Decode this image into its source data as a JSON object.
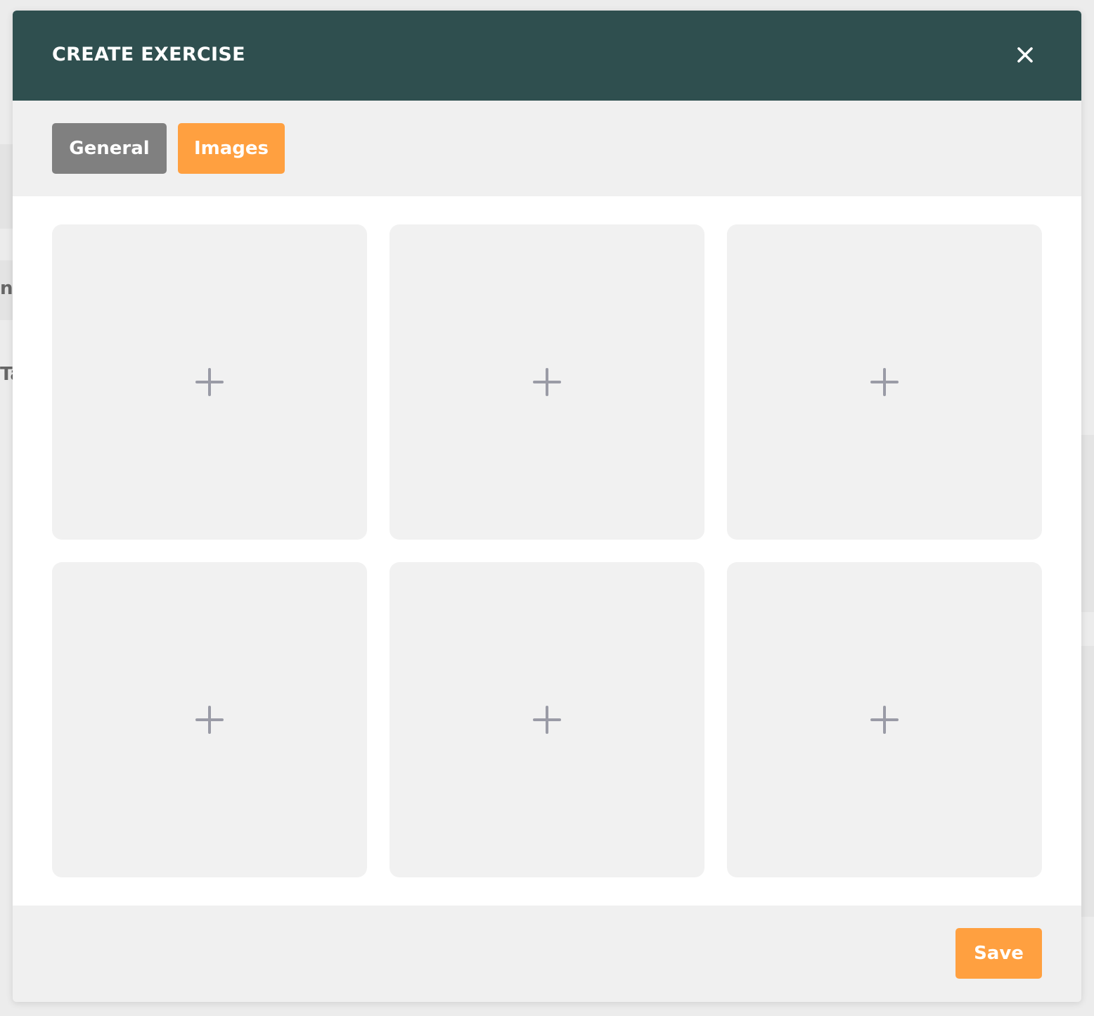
{
  "background": {
    "fragment_1": "n",
    "fragment_2": "Ta"
  },
  "modal": {
    "title": "CREATE EXERCISE",
    "close_icon": "close-icon",
    "tabs": [
      {
        "label": "General",
        "active": false
      },
      {
        "label": "Images",
        "active": true
      }
    ],
    "image_slots": [
      {
        "icon": "plus-icon"
      },
      {
        "icon": "plus-icon"
      },
      {
        "icon": "plus-icon"
      },
      {
        "icon": "plus-icon"
      },
      {
        "icon": "plus-icon"
      },
      {
        "icon": "plus-icon"
      }
    ],
    "save_label": "Save"
  },
  "colors": {
    "header": "#2f4f4f",
    "accent": "#ffa040",
    "tab_inactive": "#808080",
    "slot_bg": "#f1f1f1",
    "plus_icon": "#9a9ba6"
  }
}
